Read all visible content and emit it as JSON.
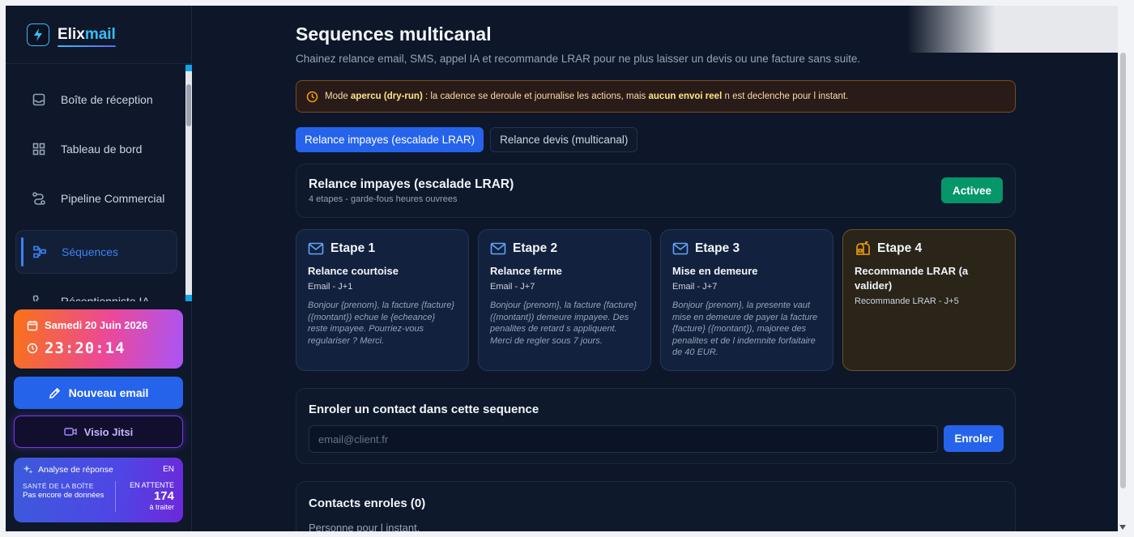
{
  "brand": {
    "name_a": "Elix",
    "name_b": "mail"
  },
  "nav": [
    {
      "label": "Boîte de réception",
      "icon": "inbox-icon"
    },
    {
      "label": "Tableau de bord",
      "icon": "dashboard-icon"
    },
    {
      "label": "Pipeline Commercial",
      "icon": "pipeline-icon"
    },
    {
      "label": "Séquences",
      "icon": "sequences-icon",
      "active": true
    },
    {
      "label": "Réceptionniste IA",
      "icon": "phone-icon"
    }
  ],
  "clock": {
    "date": "Samedi 20 Juin 2026",
    "time": "23:20:14"
  },
  "actions": {
    "new_email": "Nouveau email",
    "visio": "Visio Jitsi"
  },
  "analysis": {
    "title": "Analyse de réponse",
    "lang": "EN",
    "health_label": "SANTÉ DE LA BOÎTE",
    "health_value": "Pas encore de données",
    "pending_label": "EN ATTENTE",
    "pending_count": "174",
    "pending_sub": "à traiter"
  },
  "page": {
    "title": "Sequences multicanal",
    "subtitle": "Chainez relance email, SMS, appel IA et recommande LRAR pour ne plus laisser un devis ou une facture sans suite."
  },
  "alert": {
    "prefix": "Mode ",
    "mode": "apercu (dry-run)",
    "middle": " : la cadence se deroule et journalise les actions, mais ",
    "strong": "aucun envoi reel",
    "suffix": " n est declenche pour l instant."
  },
  "tabs": [
    {
      "label": "Relance impayes (escalade LRAR)",
      "active": true
    },
    {
      "label": "Relance devis (multicanal)",
      "active": false
    }
  ],
  "sequence": {
    "title": "Relance impayes (escalade LRAR)",
    "meta": "4 etapes - garde-fous heures ouvrees",
    "status": "Activee"
  },
  "steps": [
    {
      "title": "Etape 1",
      "name": "Relance courtoise",
      "meta": "Email - J+1",
      "body": "Bonjour {prenom}, la facture {facture} ({montant}) echue le {echeance} reste impayee. Pourriez-vous regulariser ? Merci.",
      "icon": "mail-icon"
    },
    {
      "title": "Etape 2",
      "name": "Relance ferme",
      "meta": "Email - J+7",
      "body": "Bonjour {prenom}, la facture {facture} ({montant}) demeure impayee. Des penalites de retard s appliquent. Merci de regler sous 7 jours.",
      "icon": "mail-icon"
    },
    {
      "title": "Etape 3",
      "name": "Mise en demeure",
      "meta": "Email - J+7",
      "body": "Bonjour {prenom}, la presente vaut mise en demeure de payer la facture {facture} ({montant}), majoree des penalites et de l indemnite forfaitaire de 40 EUR.",
      "icon": "mail-icon"
    },
    {
      "title": "Etape 4",
      "name": "Recommande LRAR (a valider)",
      "meta": "Recommande LRAR - J+5",
      "body": "",
      "icon": "mailbox-icon"
    }
  ],
  "enroll": {
    "title": "Enroler un contact dans cette sequence",
    "placeholder": "email@client.fr",
    "button": "Enroler"
  },
  "contacts": {
    "title": "Contacts enroles (0)",
    "empty": "Personne pour l instant."
  },
  "colors": {
    "accent": "#2563eb",
    "success": "#059669",
    "warning": "#f59e0b",
    "bg": "#0e1729"
  }
}
